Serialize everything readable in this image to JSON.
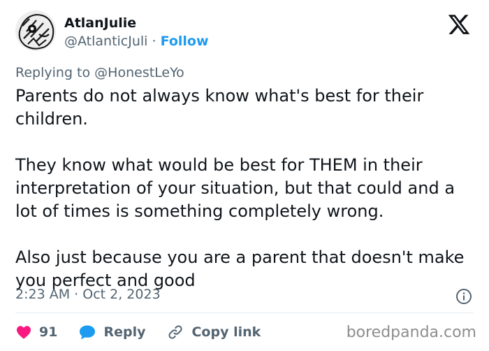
{
  "author": {
    "display_name": "AtlanJulie",
    "handle": "@AtlanticJuli",
    "separator": "·",
    "follow_label": "Follow"
  },
  "replying": {
    "prefix": "Replying to",
    "target": "@HonestLeYo"
  },
  "tweet": {
    "paragraphs": [
      "Parents do not always know what's best for their children.",
      "They know what would be best for THEM in their interpretation of your situation, but that could and a lot of times is something completely wrong.",
      "Also just because you are a parent that doesn't make you perfect and good"
    ]
  },
  "meta": {
    "time": "2:23 AM",
    "separator": "·",
    "date": "Oct 2, 2023"
  },
  "actions": {
    "like_count": "91",
    "reply_label": "Reply",
    "copy_link_label": "Copy link"
  },
  "watermark": "boredpanda.com",
  "colors": {
    "accent": "#1d9bf0",
    "like": "#f91880",
    "muted": "#536471"
  },
  "icons": [
    "x-logo-icon",
    "heart-icon",
    "reply-bubble-icon",
    "link-icon",
    "info-icon"
  ]
}
